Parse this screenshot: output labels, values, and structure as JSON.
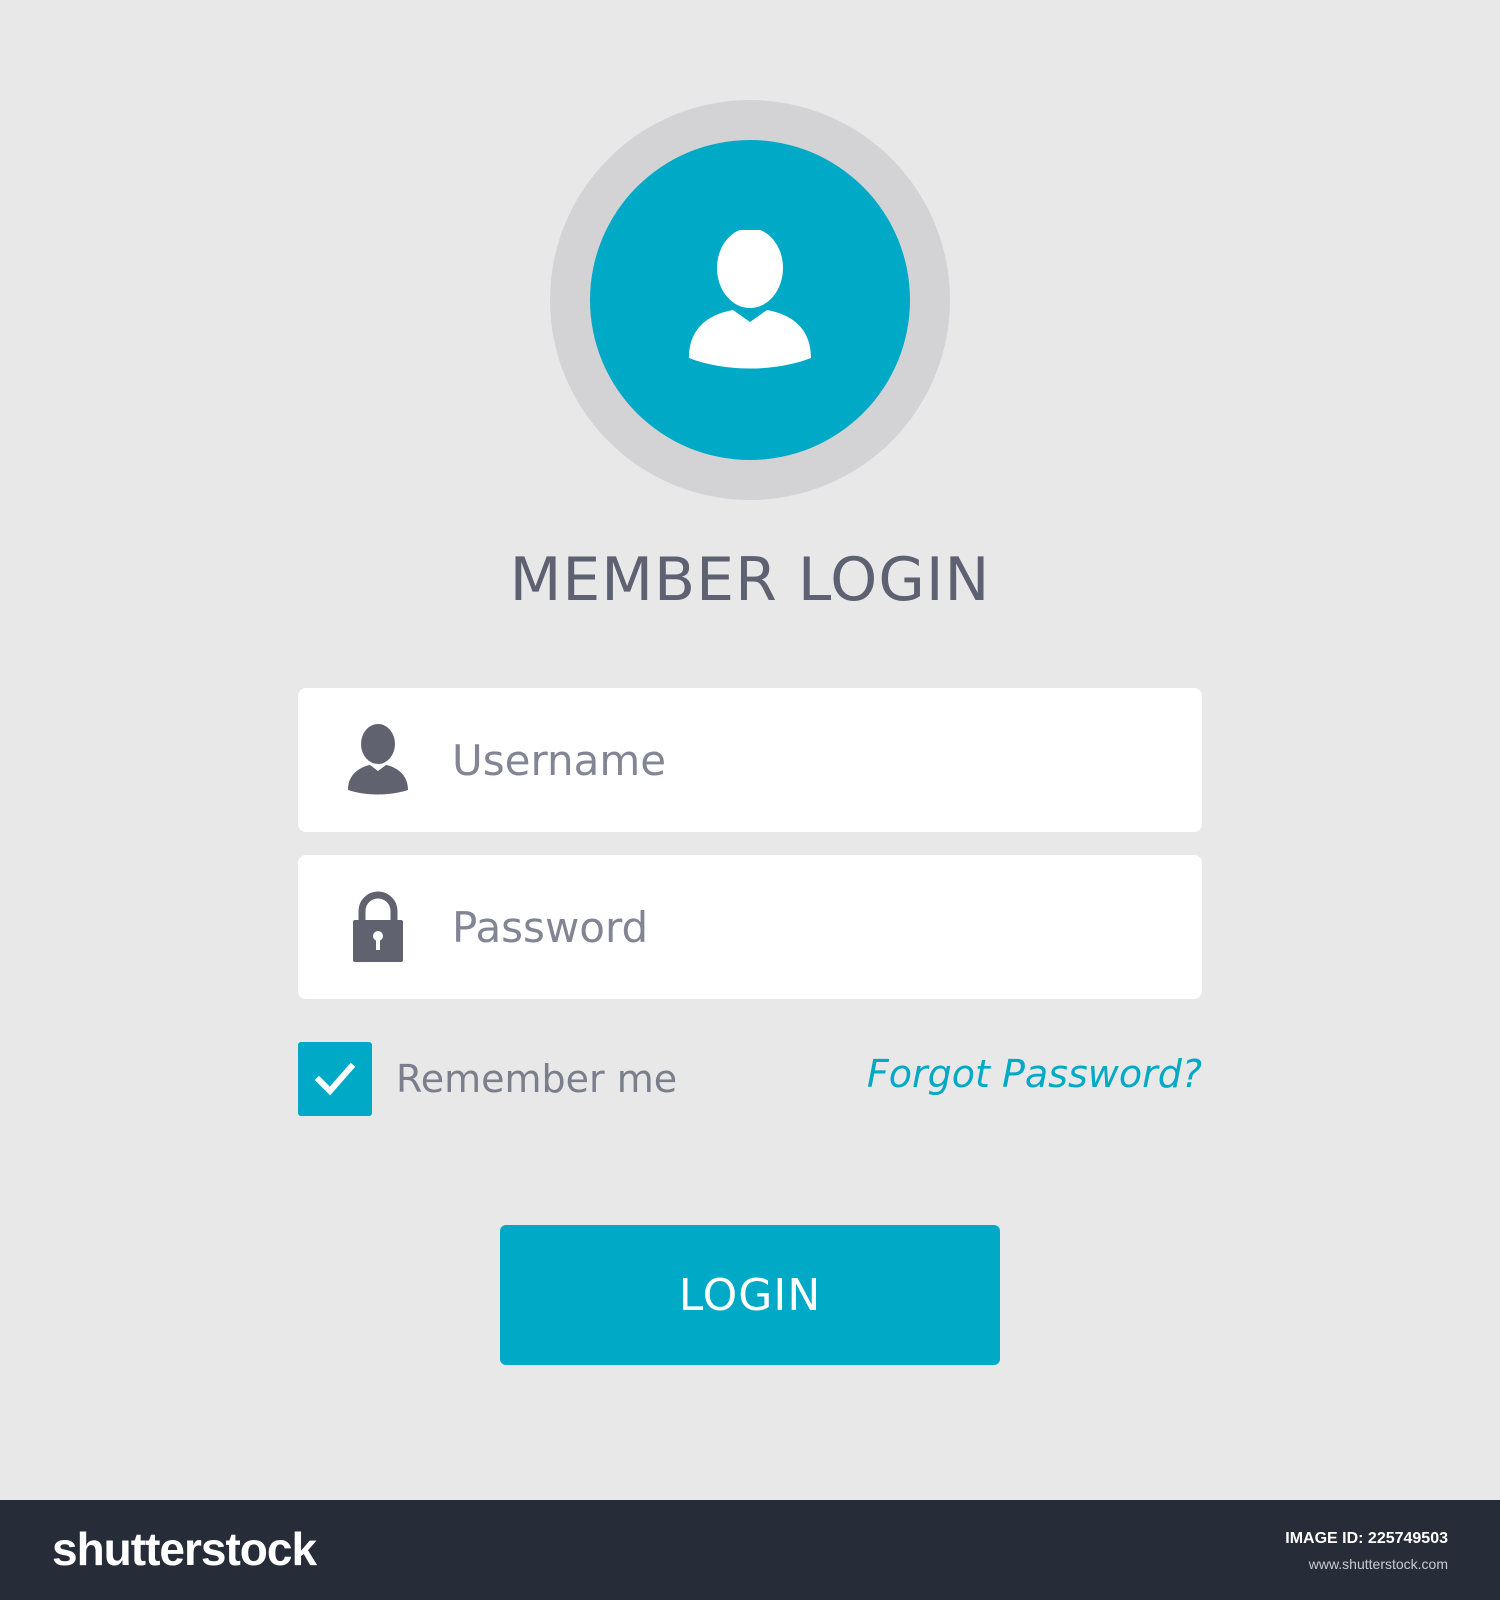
{
  "header": {
    "title": "MEMBER LOGIN"
  },
  "avatar": {
    "icon": "user-avatar-icon"
  },
  "form": {
    "username": {
      "placeholder": "Username",
      "value": "",
      "icon": "user-icon"
    },
    "password": {
      "placeholder": "Password",
      "value": "",
      "icon": "lock-icon"
    },
    "remember": {
      "label": "Remember me",
      "checked": true
    },
    "forgot_label": "Forgot Password?",
    "login_label": "LOGIN"
  },
  "watermark": {
    "logo": "shutterstock",
    "image_id": "IMAGE ID: 225749503",
    "url": "www.shutterstock.com"
  },
  "colors": {
    "accent": "#00a9c5",
    "background": "#e8e8e9",
    "text": "#5d6171",
    "ring": "#d3d3d6",
    "footer": "#262c38"
  }
}
